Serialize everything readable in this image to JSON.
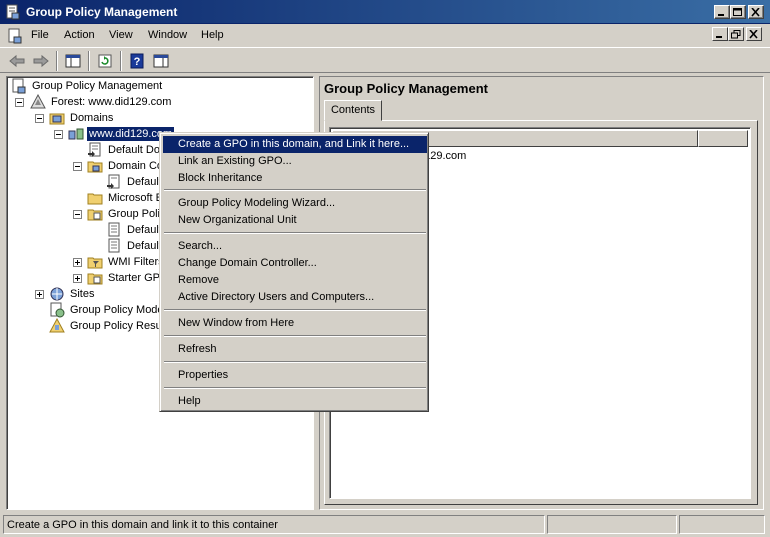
{
  "window": {
    "title": "Group Policy Management"
  },
  "menu": [
    "File",
    "Action",
    "View",
    "Window",
    "Help"
  ],
  "toolbar": {
    "buttons": [
      "back-arrow-icon",
      "forward-arrow-icon",
      "show-hide-tree-icon",
      "refresh-icon",
      "help-icon"
    ]
  },
  "tree": {
    "root": "Group Policy Management",
    "forest": "Forest: www.did129.com",
    "domains": "Domains",
    "domain": "www.did129.com",
    "default_domain_policy": "Default Do",
    "domain_controllers": "Domain Co",
    "default_dc_policy": "Default",
    "microsoft": "Microsoft E",
    "gpo_objects": "Group Polic",
    "gpo_default1": "Default",
    "gpo_default2": "Default",
    "wmi_filters": "WMI Filters",
    "starter_gpos": "Starter GPO",
    "sites": "Sites",
    "modeling": "Group Policy Model",
    "results": "Group Policy Result"
  },
  "right_pane": {
    "title": "Group Policy Management",
    "tab": "Contents",
    "list_item": "d129.com"
  },
  "context_menu": {
    "items": [
      "Create a GPO in this domain, and Link it here...",
      "Link an Existing GPO...",
      "Block Inheritance",
      "Group Policy Modeling Wizard...",
      "New Organizational Unit",
      "Search...",
      "Change Domain Controller...",
      "Remove",
      "Active Directory Users and Computers...",
      "New Window from Here",
      "Refresh",
      "Properties",
      "Help"
    ]
  },
  "status": {
    "text": "Create a GPO in this domain and link it to this container"
  },
  "colors": {
    "selection": "#0a246a",
    "face": "#d4d0c8",
    "title_start": "#0a246a",
    "title_end": "#3a6ea5"
  }
}
